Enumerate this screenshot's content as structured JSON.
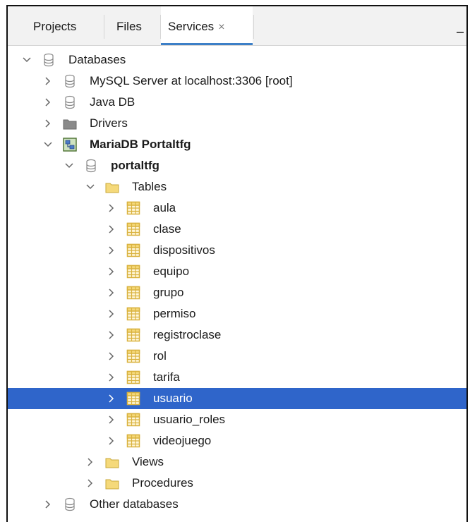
{
  "tabs": {
    "projects": "Projects",
    "files": "Files",
    "services": "Services",
    "close": "×"
  },
  "tree": [
    {
      "label": "Databases",
      "toggle": "expanded",
      "icon": "database-icon",
      "bold": false
    },
    {
      "label": "MySQL Server at localhost:3306 [root]",
      "toggle": "collapsed",
      "icon": "database-icon",
      "bold": false
    },
    {
      "label": "Java DB",
      "toggle": "collapsed",
      "icon": "database-icon",
      "bold": false
    },
    {
      "label": "Drivers",
      "toggle": "collapsed",
      "icon": "drivers-folder-icon",
      "bold": false
    },
    {
      "label": "MariaDB Portaltfg",
      "toggle": "expanded",
      "icon": "connection-icon",
      "bold": true
    },
    {
      "label": "portaltfg",
      "toggle": "expanded",
      "icon": "database-icon",
      "bold": true
    },
    {
      "label": "Tables",
      "toggle": "expanded",
      "icon": "folder-icon",
      "bold": false
    },
    {
      "label": "aula",
      "toggle": "collapsed",
      "icon": "table-icon",
      "bold": false
    },
    {
      "label": "clase",
      "toggle": "collapsed",
      "icon": "table-icon",
      "bold": false
    },
    {
      "label": "dispositivos",
      "toggle": "collapsed",
      "icon": "table-icon",
      "bold": false
    },
    {
      "label": "equipo",
      "toggle": "collapsed",
      "icon": "table-icon",
      "bold": false
    },
    {
      "label": "grupo",
      "toggle": "collapsed",
      "icon": "table-icon",
      "bold": false
    },
    {
      "label": "permiso",
      "toggle": "collapsed",
      "icon": "table-icon",
      "bold": false
    },
    {
      "label": "registroclase",
      "toggle": "collapsed",
      "icon": "table-icon",
      "bold": false
    },
    {
      "label": "rol",
      "toggle": "collapsed",
      "icon": "table-icon",
      "bold": false
    },
    {
      "label": "tarifa",
      "toggle": "collapsed",
      "icon": "table-icon",
      "bold": false
    },
    {
      "label": "usuario",
      "toggle": "collapsed",
      "icon": "table-icon",
      "bold": false,
      "selected": true
    },
    {
      "label": "usuario_roles",
      "toggle": "collapsed",
      "icon": "table-icon",
      "bold": false
    },
    {
      "label": "videojuego",
      "toggle": "collapsed",
      "icon": "table-icon",
      "bold": false
    },
    {
      "label": "Views",
      "toggle": "collapsed",
      "icon": "folder-icon",
      "bold": false
    },
    {
      "label": "Procedures",
      "toggle": "collapsed",
      "icon": "folder-icon",
      "bold": false
    },
    {
      "label": "Other databases",
      "toggle": "collapsed",
      "icon": "database-icon",
      "bold": false
    }
  ],
  "colors": {
    "selection": "#2f65ca",
    "tab_underline": "#3c7fc7",
    "folder": "#f5d97a",
    "table_grid": "#d9b23f"
  }
}
